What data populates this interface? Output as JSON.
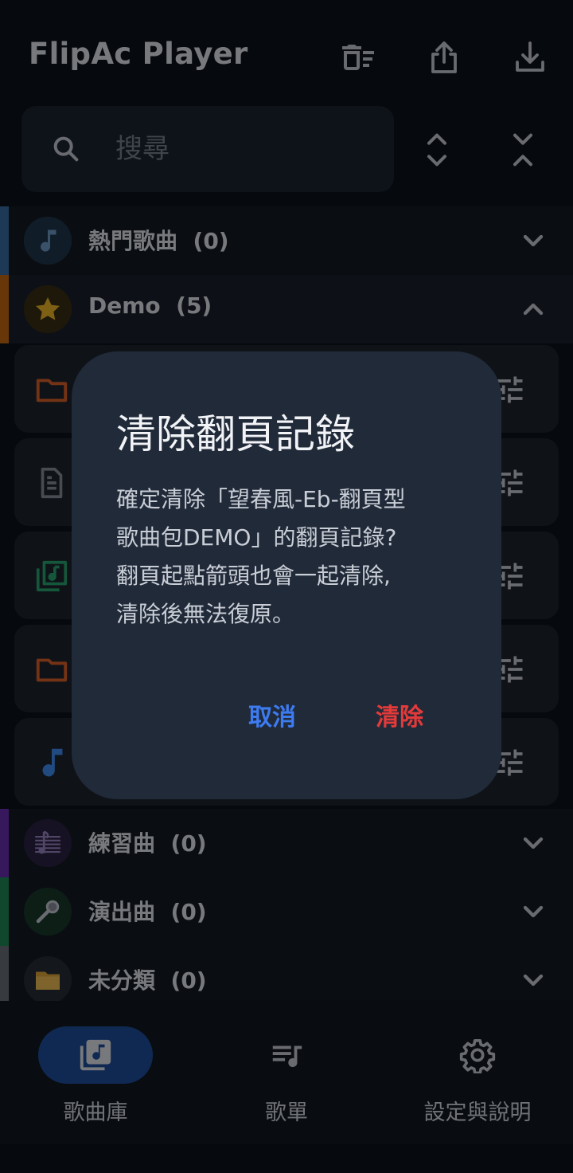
{
  "app": {
    "title": "FlipAc Player"
  },
  "toolbar": {
    "icons": [
      "delete-sweep-icon",
      "share-icon",
      "download-icon"
    ]
  },
  "search": {
    "placeholder": "搜尋",
    "value": ""
  },
  "categories": [
    {
      "label": "熱門歌曲",
      "count": "(0)",
      "accent": "#3b6ea6",
      "icon": "music-note-icon",
      "expanded": false
    },
    {
      "label": "Demo",
      "count": "(5)",
      "accent": "#c56a14",
      "icon": "star-icon",
      "expanded": true
    },
    {
      "label": "練習曲",
      "count": "(0)",
      "accent": "#6a2fb0",
      "icon": "music-score-icon",
      "expanded": false
    },
    {
      "label": "演出曲",
      "count": "(0)",
      "accent": "#1e8a55",
      "icon": "microphone-icon",
      "expanded": false
    },
    {
      "label": "未分類",
      "count": "(0)",
      "accent": "#6a6f78",
      "icon": "folder-icon",
      "expanded": false
    }
  ],
  "demo_songs": [
    {
      "icon": "folder-icon"
    },
    {
      "icon": "document-icon"
    },
    {
      "icon": "music-library-icon"
    },
    {
      "icon": "folder-icon"
    },
    {
      "icon": "music-note-icon"
    }
  ],
  "dialog": {
    "title": "清除翻頁記錄",
    "message": "確定清除「望春風-Eb-翻頁型\n歌曲包DEMO」的翻頁記錄?\n翻頁起點箭頭也會一起清除,\n清除後無法復原。",
    "cancel_label": "取消",
    "confirm_label": "清除"
  },
  "nav": [
    {
      "label": "歌曲庫",
      "icon": "music-library-icon",
      "active": true
    },
    {
      "label": "歌單",
      "icon": "playlist-icon",
      "active": false
    },
    {
      "label": "設定與說明",
      "icon": "settings-icon",
      "active": false
    }
  ],
  "colors": {
    "background": "#0d131b",
    "dialog": "#212a39",
    "cancel": "#3d7bf0",
    "confirm": "#e53a3a",
    "nav_active": "#1f4fa0"
  }
}
